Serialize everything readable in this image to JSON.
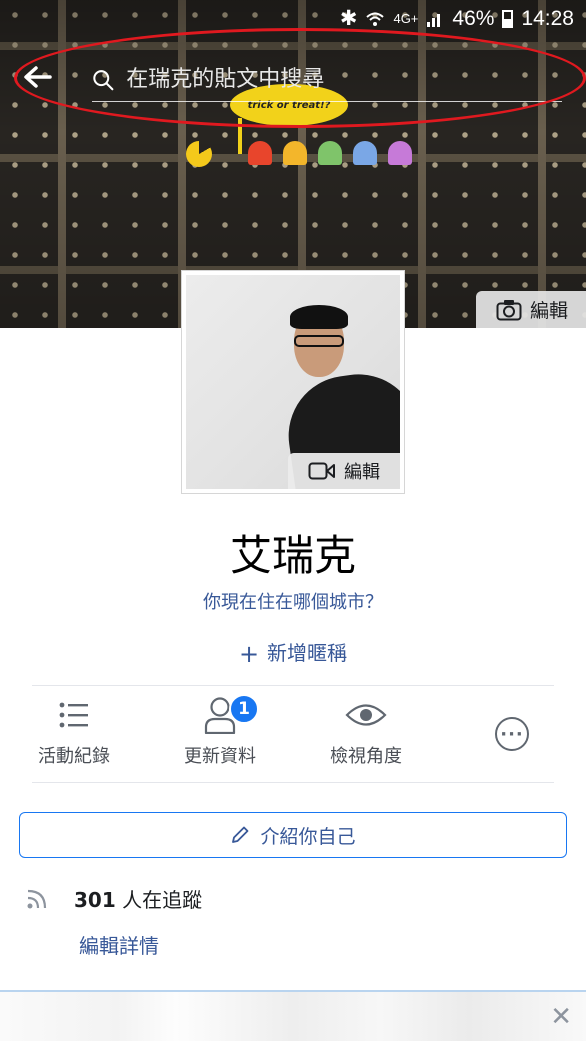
{
  "status_bar": {
    "network": "4G+",
    "battery": "46%",
    "time": "14:28"
  },
  "search": {
    "placeholder": "在瑞克的貼文中搜尋"
  },
  "cover": {
    "bubble_text": "trick or treat!?",
    "edit_label": "編輯"
  },
  "profile_photo": {
    "edit_label": "編輯"
  },
  "profile": {
    "name": "艾瑞克",
    "city_prompt": "你現在住在哪個城市？",
    "add_nickname": "新增暱稱"
  },
  "actions": [
    {
      "label": "活動紀錄",
      "icon": "list-icon"
    },
    {
      "label": "更新資料",
      "icon": "person-icon",
      "badge": "1"
    },
    {
      "label": "檢視角度",
      "icon": "eye-icon"
    },
    {
      "label": "",
      "icon": "more-icon"
    }
  ],
  "intro": {
    "label": "介紹你自己"
  },
  "followers": {
    "count": "301",
    "suffix": "人在追蹤"
  },
  "edit_details": "編輯詳情",
  "colors": {
    "link": "#385898",
    "accent": "#1877f2",
    "annotation": "#e0191f"
  }
}
